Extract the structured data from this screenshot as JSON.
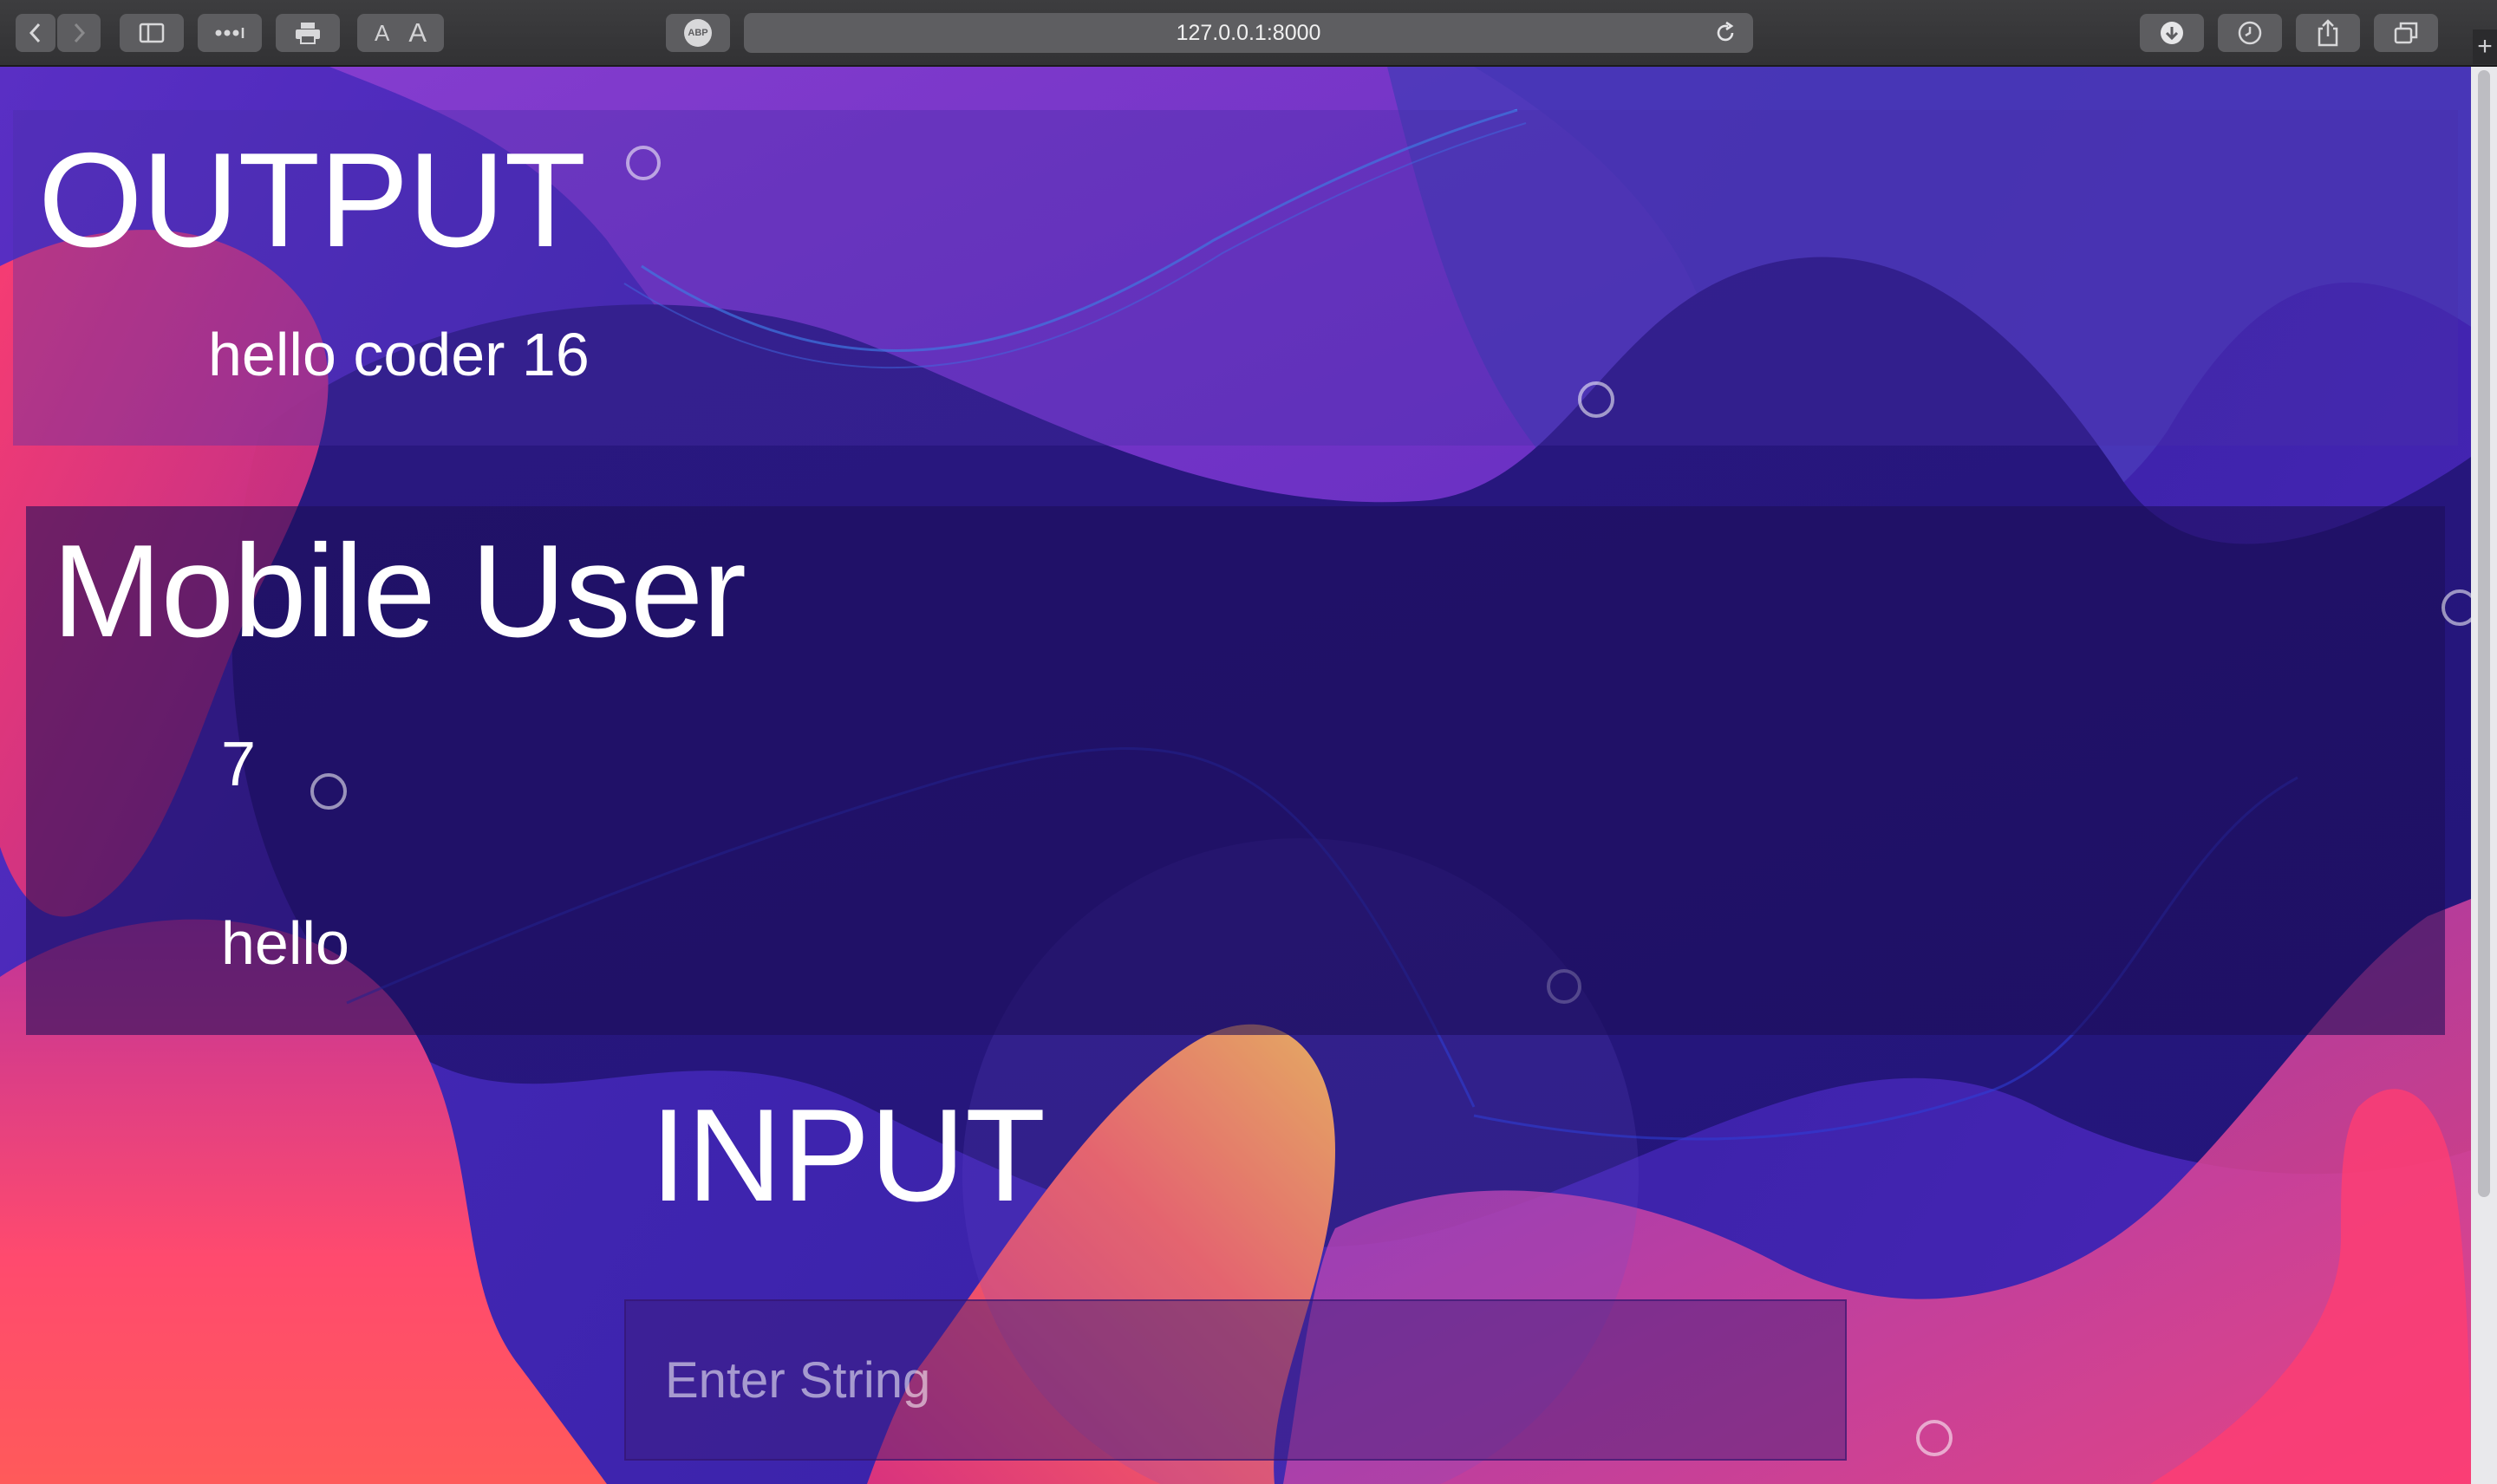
{
  "browser": {
    "url": "127.0.0.1:8000",
    "adblock_label": "ABP",
    "text_size_small": "A",
    "text_size_large": "A",
    "new_tab_label": "+"
  },
  "output": {
    "title": "OUTPUT",
    "value": "hello coder 16"
  },
  "mobile_user": {
    "title": "Mobile User",
    "count": "7",
    "message": "hello"
  },
  "input": {
    "title": "INPUT",
    "placeholder": "Enter String",
    "value": ""
  }
}
